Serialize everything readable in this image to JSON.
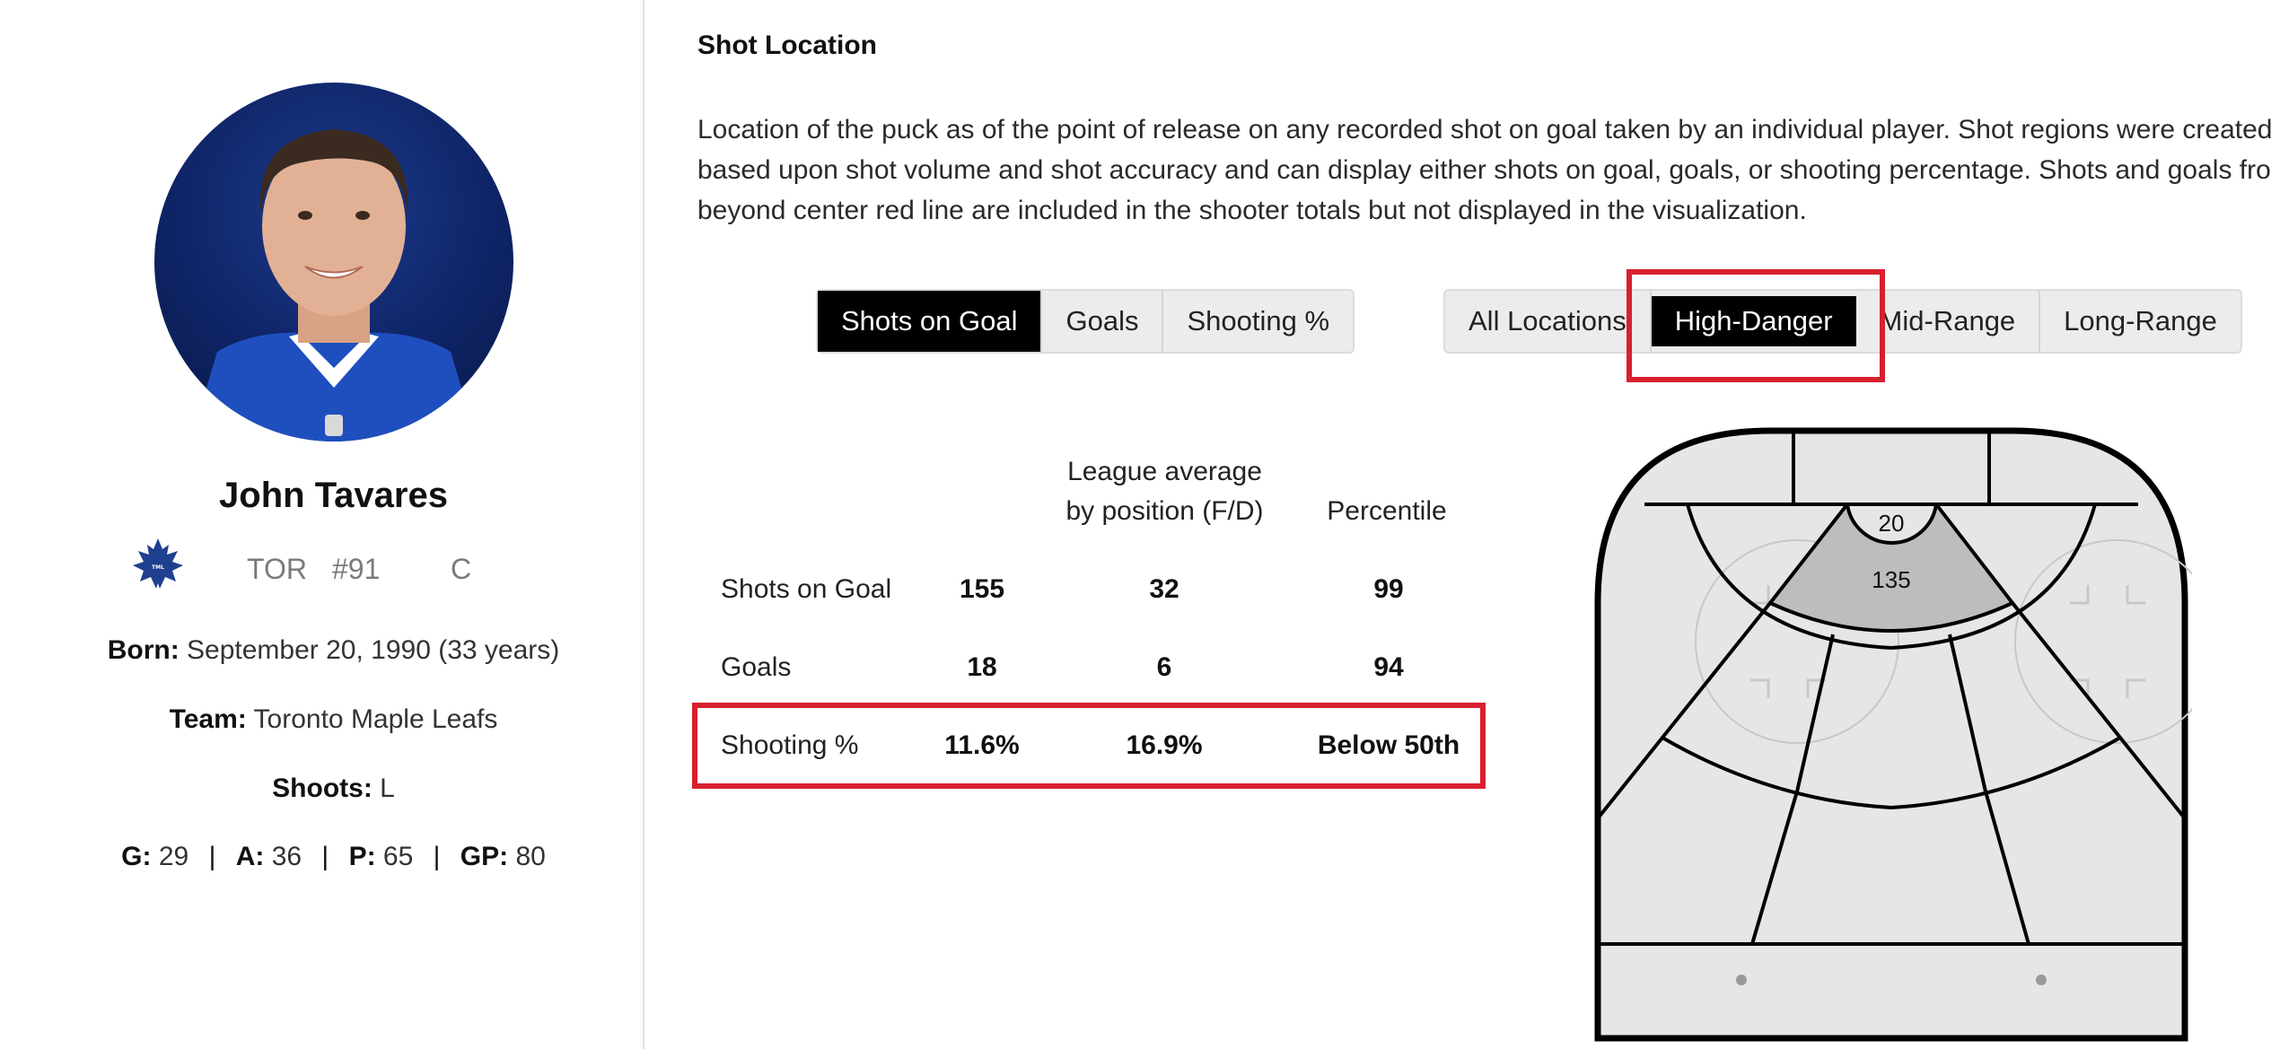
{
  "player": {
    "name": "John Tavares",
    "team_abbr": "TOR",
    "jersey": "#91",
    "position": "C",
    "born_label": "Born:",
    "born_value": "September 20, 1990 (33 years)",
    "team_label": "Team:",
    "team_value": "Toronto Maple Leafs",
    "shoots_label": "Shoots:",
    "shoots_value": "L",
    "stats": [
      {
        "label": "G:",
        "value": "29"
      },
      {
        "label": "A:",
        "value": "36"
      },
      {
        "label": "P:",
        "value": "65"
      },
      {
        "label": "GP:",
        "value": "80"
      }
    ],
    "stats_separator": "|",
    "logo_text": "TORONTO MAPLE LEAFS"
  },
  "section": {
    "title": "Shot Location",
    "description": "Location of the puck as of the point of release on any recorded shot on goal taken by an individual player. Shot regions were created based upon shot volume and shot accuracy and can display either shots on goal, goals, or shooting percentage. Shots and goals from beyond center red line are included in the shooter totals but not displayed in the visualization."
  },
  "metric_toggle": {
    "options": [
      "Shots on Goal",
      "Goals",
      "Shooting %"
    ],
    "selected": "Shots on Goal"
  },
  "range_toggle": {
    "options": [
      "All Locations",
      "High-Danger",
      "Mid-Range",
      "Long-Range"
    ],
    "selected": "High-Danger"
  },
  "stats_table": {
    "headers": {
      "league_avg_line1": "League average",
      "league_avg_line2": "by position (F/D)",
      "percentile": "Percentile"
    },
    "rows": [
      {
        "label": "Shots on Goal",
        "value": "155",
        "league_avg": "32",
        "percentile": "99"
      },
      {
        "label": "Goals",
        "value": "18",
        "league_avg": "6",
        "percentile": "94"
      },
      {
        "label": "Shooting %",
        "value": "11.6%",
        "league_avg": "16.9%",
        "percentile": "Below 50th"
      }
    ]
  },
  "rink": {
    "crease_value": "20",
    "slot_value": "135",
    "colors": {
      "zone_fill": "#e6e6e6",
      "highlight_fill": "#bdbdbd",
      "line": "#000000",
      "faceoff": "#c8c8c8"
    }
  },
  "colors": {
    "highlight_box": "#d8202f",
    "active_button": "#000000"
  }
}
